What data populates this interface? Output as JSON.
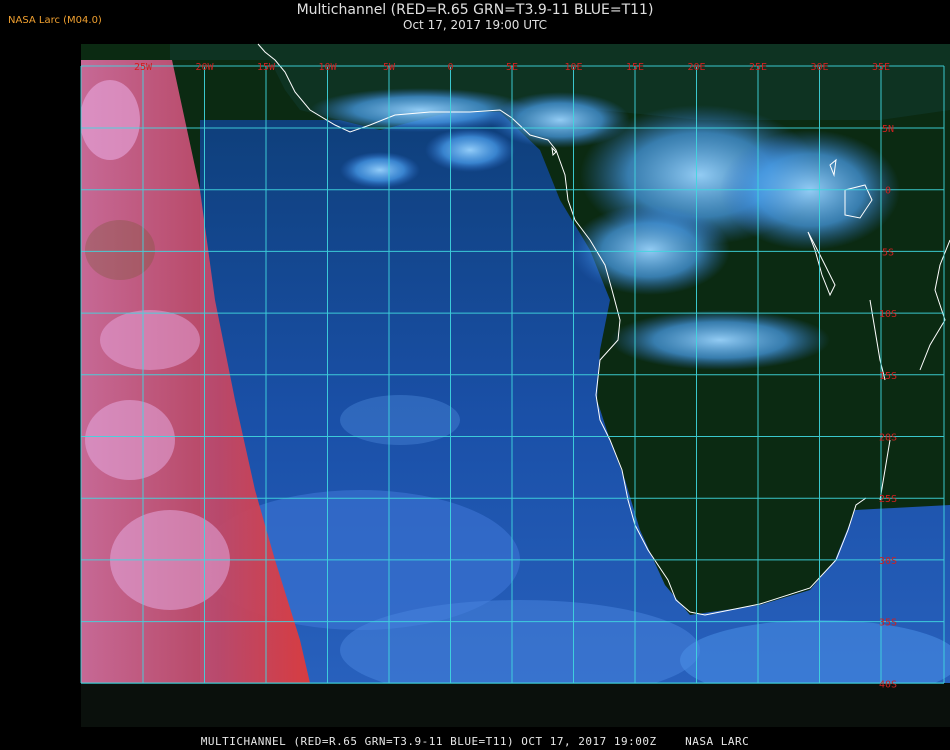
{
  "header": {
    "credit": "NASA Larc (M04.0)",
    "title": "Multichannel (RED=R.65 GRN=T3.9-11 BLUE=T11)",
    "subtitle": "Oct 17, 2017 19:00 UTC"
  },
  "footer": {
    "caption": "MULTICHANNEL (RED=R.65 GRN=T3.9-11 BLUE=T11) OCT 17, 2017 19:00Z    NASA LARC"
  },
  "map": {
    "longitude_labels": [
      "25W",
      "20W",
      "15W",
      "10W",
      "5W",
      "0",
      "5E",
      "10E",
      "15E",
      "20E",
      "25E",
      "30E",
      "35E"
    ],
    "latitude_labels": [
      "5N",
      "0",
      "5S",
      "10S",
      "15S",
      "20S",
      "25S",
      "30S",
      "35S",
      "40S"
    ],
    "colors": {
      "grid": "#40d8e0",
      "grid_label": "#d02020",
      "coastline": "#ffffff",
      "ocean": "#1a4fa8",
      "land": "#123a1e",
      "cloud": "#4aa8f0",
      "visible_strip": "#e0507a"
    }
  }
}
